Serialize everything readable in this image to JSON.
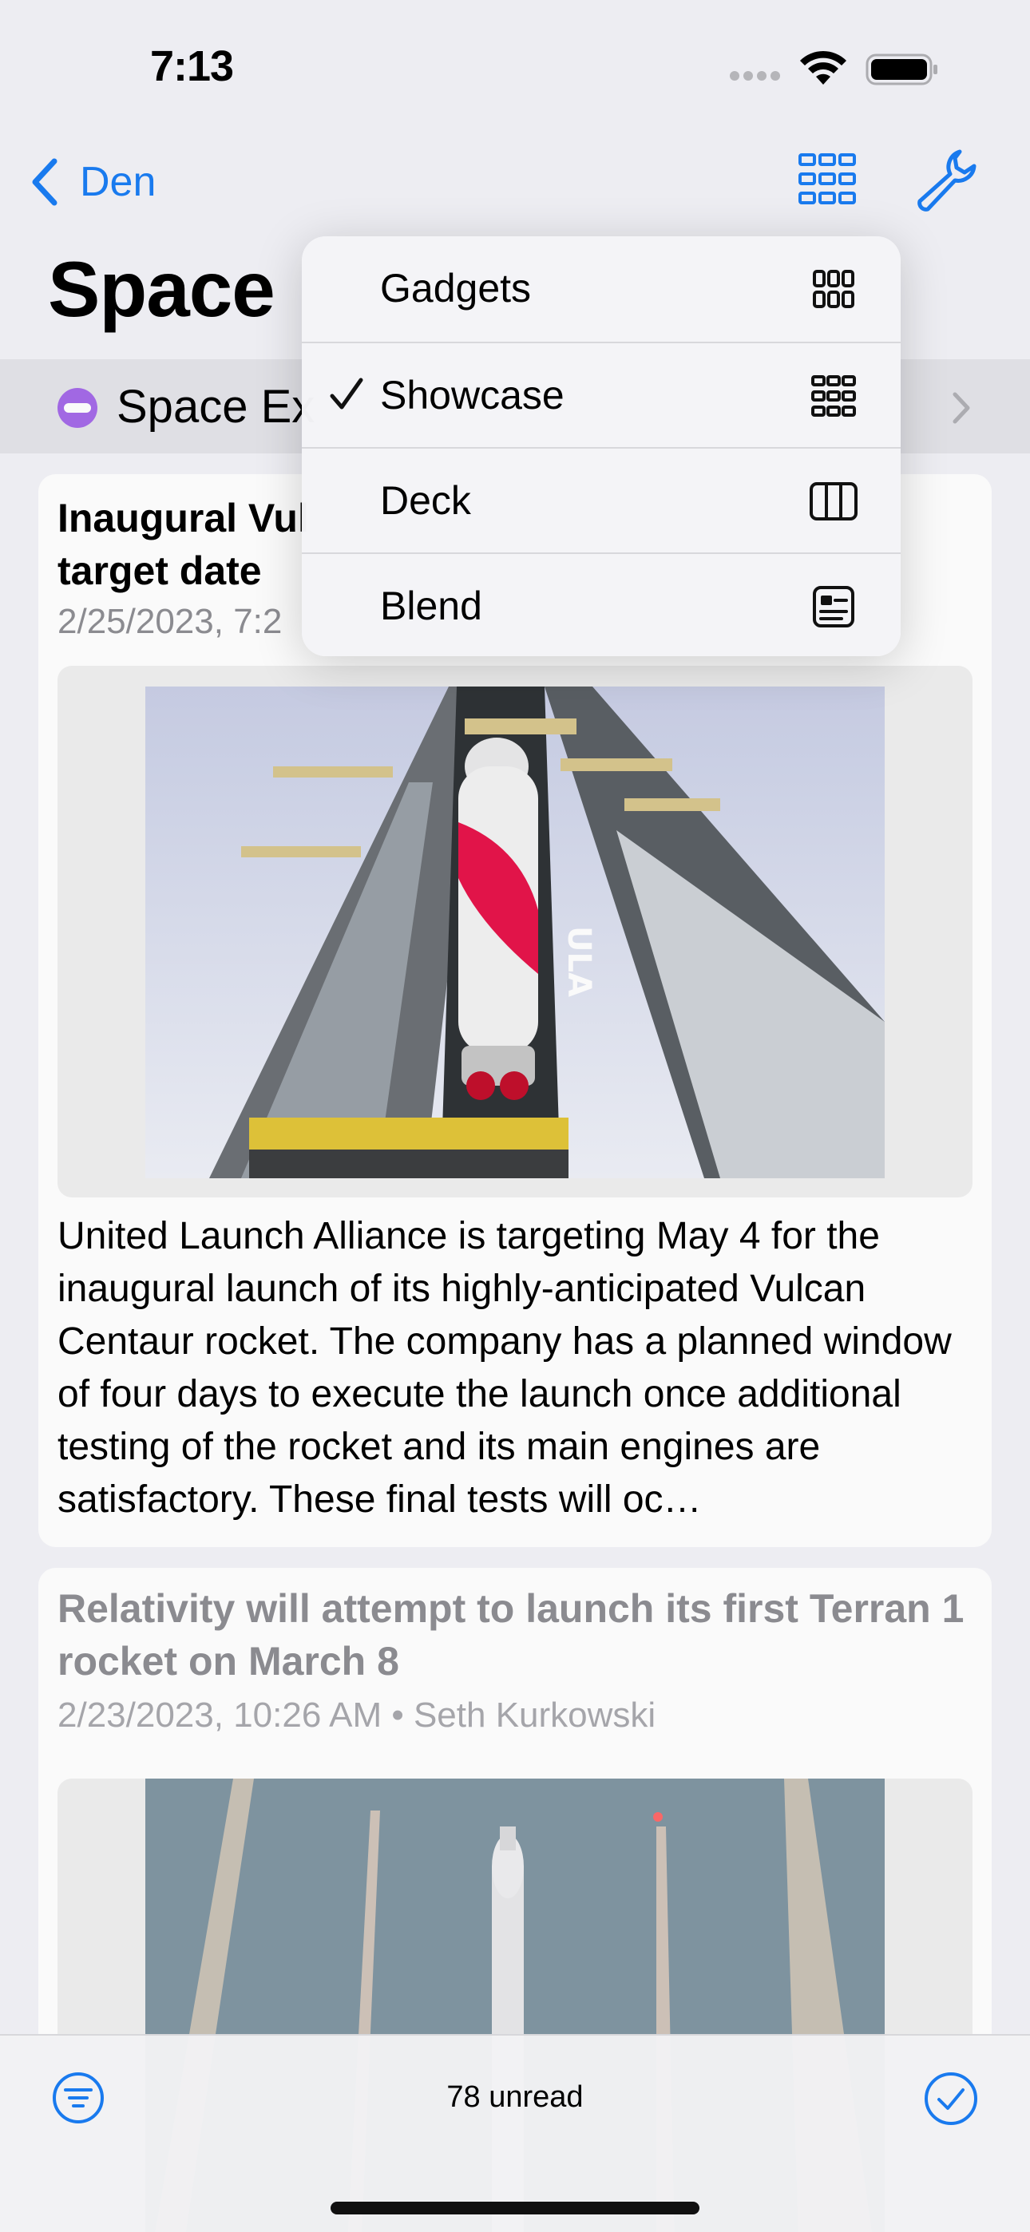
{
  "status": {
    "time": "7:13"
  },
  "nav": {
    "back_label": "Den"
  },
  "page": {
    "title": "Space"
  },
  "feed": {
    "name": "Space Ex"
  },
  "articles": [
    {
      "title": "Inaugural Vulcan launch target date",
      "title_visible": "Inaugural Vul\ntarget date",
      "meta": "2/25/2023, 7:2",
      "body": "United Launch Alliance is targeting May 4 for the inaugural launch of its highly-anticipated Vulcan Centaur rocket. The company has a planned window of four days to execute the launch once additional testing of the rocket and its main engines are satisfactory. These final tests will oc…",
      "image": "ULA Vulcan rocket in vertical integration facility",
      "image_text": "ULA"
    },
    {
      "title": "Relativity will attempt to launch its first Terran 1 rocket on March 8",
      "meta": "2/23/2023, 10:26 AM • Seth Kurkowski",
      "image": "Terran 1 rocket on launch pad"
    }
  ],
  "menu": {
    "items": [
      {
        "label": "Gadgets",
        "icon": "grid-3x2-icon",
        "selected": false
      },
      {
        "label": "Showcase",
        "icon": "grid-3x3-rows-icon",
        "selected": true
      },
      {
        "label": "Deck",
        "icon": "columns-icon",
        "selected": false
      },
      {
        "label": "Blend",
        "icon": "card-text-icon",
        "selected": false
      }
    ]
  },
  "toolbar": {
    "unread": "78 unread"
  },
  "colors": {
    "accent": "#1a7df3",
    "feed_icon": "#a56be8",
    "meta": "#8e8e93"
  }
}
